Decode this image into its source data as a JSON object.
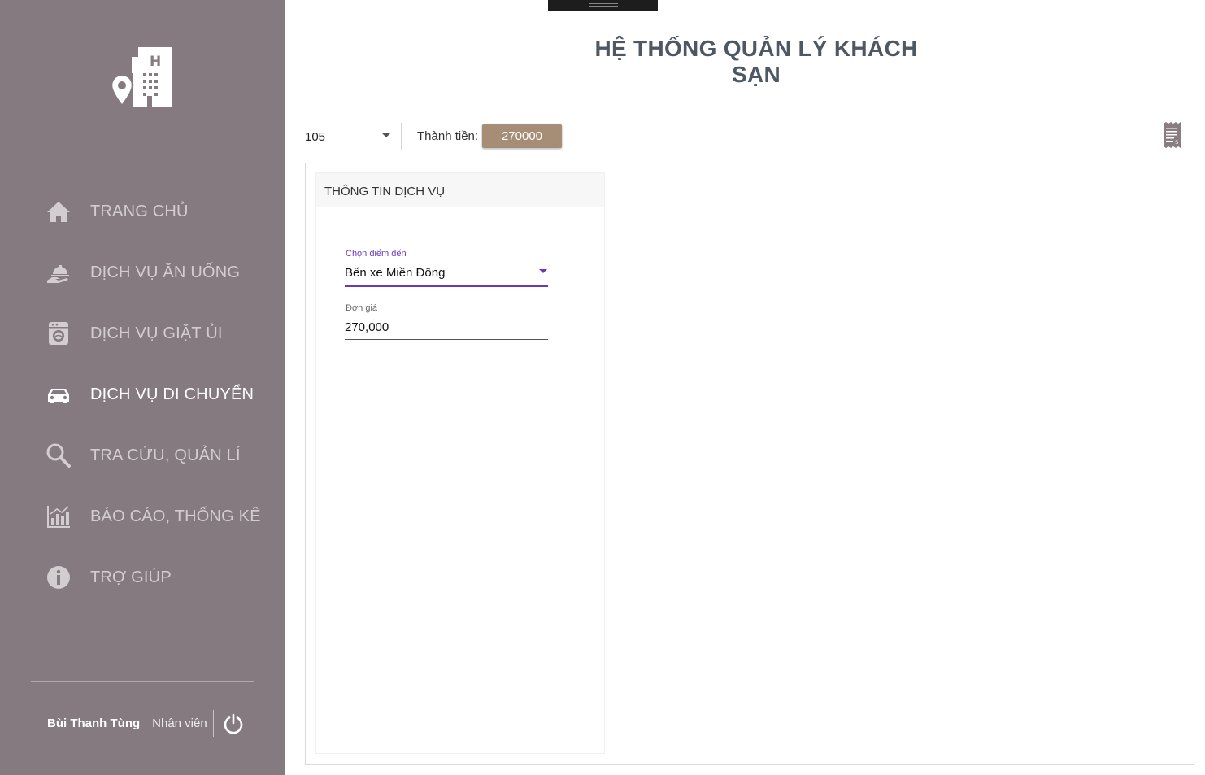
{
  "app": {
    "title": "HỆ THỐNG QUẢN LÝ KHÁCH SẠN"
  },
  "sidebar": {
    "logo_icon": "hotel-location-icon",
    "items": [
      {
        "label": "TRANG CHỦ",
        "icon": "home-icon",
        "active": false
      },
      {
        "label": "DỊCH VỤ ĂN UỐNG",
        "icon": "room-service-icon",
        "active": false
      },
      {
        "label": "DỊCH VỤ GIẶT ỦI",
        "icon": "washing-machine-icon",
        "active": false
      },
      {
        "label": "DỊCH VỤ DI CHUYỂN",
        "icon": "car-icon",
        "active": true
      },
      {
        "label": "TRA CỨU, QUẢN LÍ",
        "icon": "search-icon",
        "active": false
      },
      {
        "label": "BÁO CÁO, THỐNG KÊ",
        "icon": "chart-icon",
        "active": false
      },
      {
        "label": "TRỢ GIÚP",
        "icon": "info-icon",
        "active": false
      }
    ],
    "user": {
      "name": "Bùi Thanh Tùng",
      "role": "Nhân viên"
    },
    "power_icon": "power-icon"
  },
  "toolbar": {
    "room": "105",
    "total_label": "Thành tiền:",
    "total_value": "270000",
    "receipt_icon": "receipt-icon"
  },
  "service_card": {
    "header": "THÔNG TIN DỊCH VỤ",
    "destination": {
      "label": "Chọn điểm đến",
      "value": "Bến xe Miền Đông"
    },
    "price": {
      "label": "Đơn giá",
      "value": "270,000"
    }
  },
  "colors": {
    "sidebar_bg": "#857a7f",
    "accent": "#673ab7",
    "badge_bg": "#a68d75"
  }
}
